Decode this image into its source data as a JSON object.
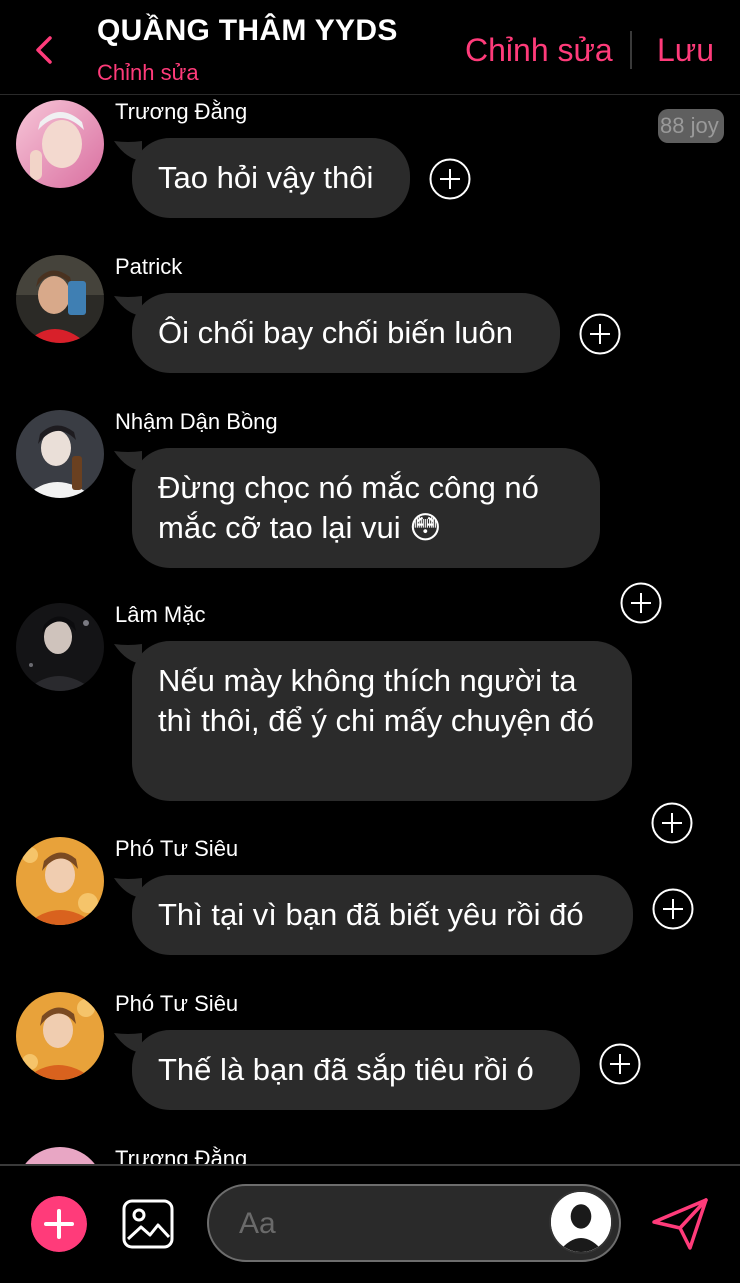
{
  "colors": {
    "accent": "#ff3b7a",
    "bubble": "#2b2b2b",
    "background": "#000000"
  },
  "header": {
    "title": "QUẦNG THÂM YYDS",
    "subtitle": "Chỉnh sửa",
    "edit_label": "Chỉnh sửa",
    "save_label": "Lưu",
    "back_icon": "chevron-left-icon"
  },
  "badge": "88 joy",
  "messages": [
    {
      "sender": "Trương Đằng",
      "text": "Tao hỏi vậy thôi"
    },
    {
      "sender": "Patrick",
      "text": "Ôi chối bay chối biến luôn"
    },
    {
      "sender": "Nhậm Dận Bồng",
      "text": "Đừng chọc nó mắc công nó mắc cỡ tao lại vui 😳"
    },
    {
      "sender": "Lâm Mặc",
      "text": "Nếu mày không thích người ta thì thôi, để ý chi mấy chuyện đó"
    },
    {
      "sender": "Phó Tư Siêu",
      "text": "Thì tại vì bạn đã biết yêu rồi đó"
    },
    {
      "sender": "Phó Tư Siêu",
      "text": "Thế là bạn đã sắp tiêu rồi ó"
    },
    {
      "sender": "Trương Đằng",
      "text": ""
    }
  ],
  "composer": {
    "placeholder": "Aa",
    "value": "",
    "plus_icon": "plus-icon",
    "image_icon": "image-icon",
    "send_icon": "send-icon",
    "persona_icon": "user-silhouette-icon"
  }
}
